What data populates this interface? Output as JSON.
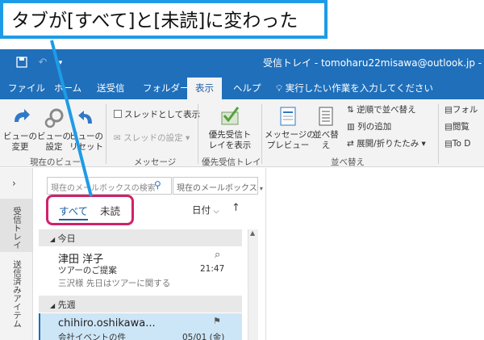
{
  "callout": {
    "text": "タブが[すべて]と[未読]に変わった"
  },
  "titlebar": {
    "title": "受信トレイ - tomoharu22misawa@outlook.jp - Ou"
  },
  "menu": {
    "items": [
      "ファイル",
      "ホーム",
      "送受信",
      "フォルダー",
      "表示",
      "ヘルプ"
    ],
    "active_index": 4,
    "tell_me": "実行したい作業を入力してください"
  },
  "ribbon": {
    "change_view": "ビューの\n変更",
    "view_settings": "ビューの\n設定",
    "reset_view": "ビューの\nリセット",
    "group_current_view": "現在のビュー",
    "show_as_thread": "スレッドとして表示",
    "thread_settings": "スレッドの設定",
    "group_messages": "メッセージ",
    "focused_inbox": "優先受信ト\nレイを表示",
    "group_focused": "優先受信トレイ",
    "message_preview": "メッセージの\nプレビュー",
    "arrangement": "並べ替え",
    "reverse_sort": "逆順で並べ替え",
    "add_columns": "列の追加",
    "expand_collapse": "展開/折りたたみ",
    "group_arrangement": "並べ替え",
    "folder_pane": "フォル",
    "reading_pane": "閲覧",
    "todo_bar": "To D"
  },
  "leftnav": {
    "inbox": "受信トレイ",
    "sent": "送信済みアイテム"
  },
  "list": {
    "search_placeholder": "現在のメールボックスの検索",
    "scope": "現在のメールボックス",
    "tab_all": "すべて",
    "tab_unread": "未読",
    "sort_label": "日付",
    "sort_arrow": "↑",
    "groups": [
      {
        "label": "今日",
        "messages": [
          {
            "sender": "津田 洋子",
            "subject": "ツアーのご提案",
            "preview": "三沢様 先日はツアーに関する",
            "time": "21:47"
          }
        ]
      },
      {
        "label": "先週",
        "messages": [
          {
            "sender": "chihiro.oshikawa...",
            "subject": "会社イベントの件",
            "time": "05/01 (金)"
          }
        ]
      }
    ]
  },
  "colors": {
    "accent": "#1f6fba",
    "callout_border": "#1e9be6",
    "highlight": "#d0226a",
    "selected_row": "#cde6f7"
  }
}
